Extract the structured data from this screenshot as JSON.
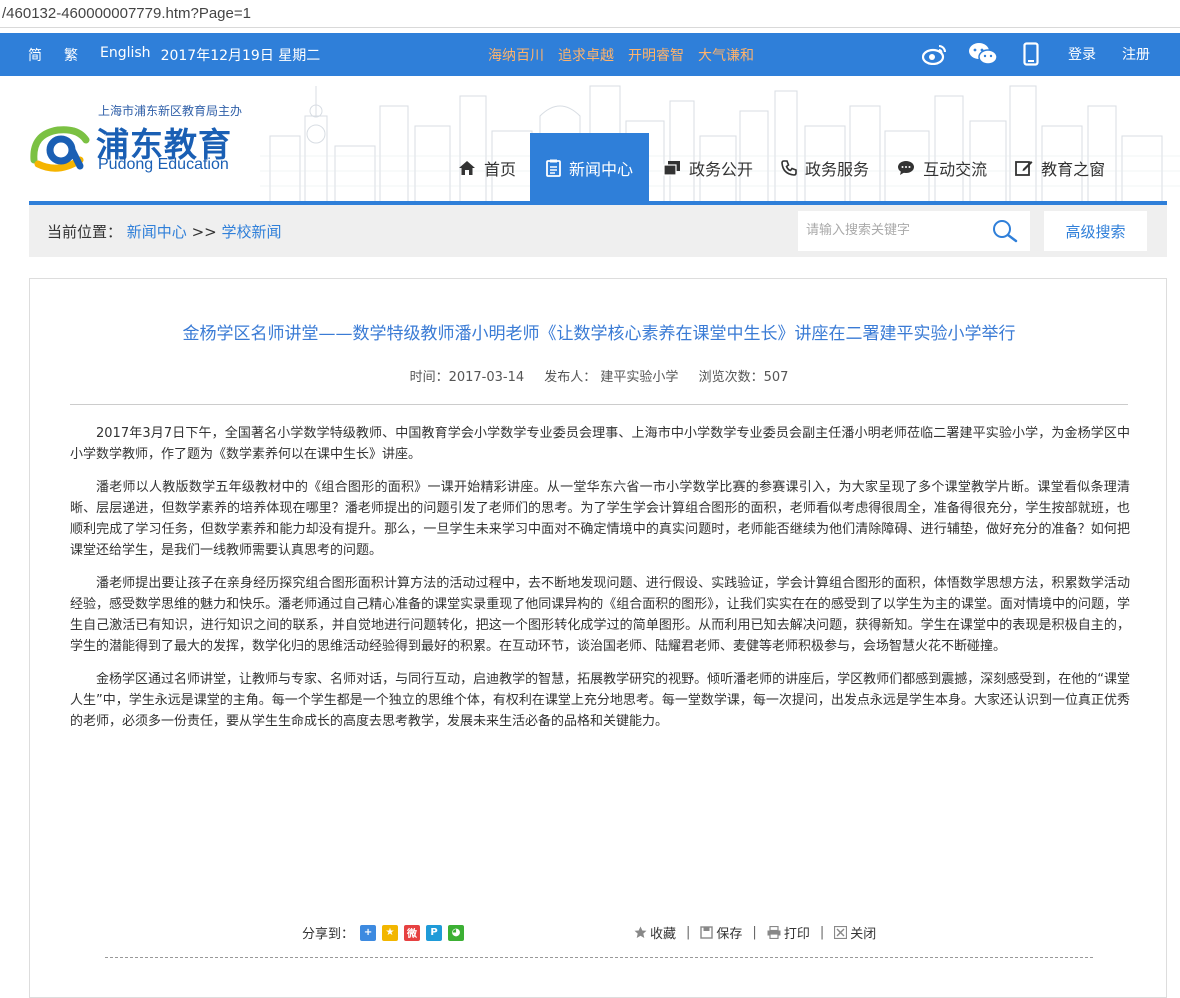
{
  "browser": {
    "url": "/460132-460000007779.htm?Page=1"
  },
  "topbar": {
    "lang_simplified": "简",
    "lang_traditional": "繁",
    "lang_english": "English",
    "date": "2017年12月19日 星期二",
    "slogans": [
      "海纳百川",
      "追求卓越",
      "开明睿智",
      "大气谦和"
    ],
    "login": "登录",
    "register": "注册",
    "icons": [
      "weibo-icon",
      "wechat-icon",
      "mobile-icon"
    ]
  },
  "logo": {
    "owner": "上海市浦东新区教育局主办",
    "name_cn": "浦东教育",
    "name_en": "Pudong Education"
  },
  "nav": {
    "items": [
      {
        "label": "首页",
        "icon": "home-icon"
      },
      {
        "label": "新闻中心",
        "icon": "document-icon",
        "active": true
      },
      {
        "label": "政务公开",
        "icon": "stack-icon"
      },
      {
        "label": "政务服务",
        "icon": "phone-icon"
      },
      {
        "label": "互动交流",
        "icon": "chat-icon"
      },
      {
        "label": "教育之窗",
        "icon": "edit-icon"
      }
    ]
  },
  "breadcrumb": {
    "prefix": "当前位置：",
    "level1": "新闻中心",
    "separator": ">>",
    "level2": "学校新闻"
  },
  "search": {
    "placeholder": "请输入搜索关键字",
    "advanced_label": "高级搜索"
  },
  "article": {
    "title": "金杨学区名师讲堂——数学特级教师潘小明老师《让数学核心素养在课堂中生长》讲座在二署建平实验小学举行",
    "time": "时间：2017-03-14",
    "publisher": "发布人： 建平实验小学",
    "views": "浏览次数：507",
    "paragraphs": [
      "2017年3月7日下午，全国著名小学数学特级教师、中国教育学会小学数学专业委员会理事、上海市中小学数学专业委员会副主任潘小明老师莅临二署建平实验小学，为金杨学区中小学数学教师，作了题为《数学素养何以在课中生长》讲座。",
      "潘老师以人教版数学五年级教材中的《组合图形的面积》一课开始精彩讲座。从一堂华东六省一市小学数学比赛的参赛课引入，为大家呈现了多个课堂教学片断。课堂看似条理清晰、层层递进，但数学素养的培养体现在哪里？潘老师提出的问题引发了老师们的思考。为了学生学会计算组合图形的面积，老师看似考虑得很周全，准备得很充分，学生按部就班，也顺利完成了学习任务，但数学素养和能力却没有提升。那么，一旦学生未来学习中面对不确定情境中的真实问题时，老师能否继续为他们清除障碍、进行辅垫，做好充分的准备？如何把课堂还给学生，是我们一线教师需要认真思考的问题。",
      "潘老师提出要让孩子在亲身经历探究组合图形面积计算方法的活动过程中，去不断地发现问题、进行假设、实践验证，学会计算组合图形的面积，体悟数学思想方法，积累数学活动经验，感受数学思维的魅力和快乐。潘老师通过自己精心准备的课堂实录重现了他同课异构的《组合面积的图形》，让我们实实在在的感受到了以学生为主的课堂。面对情境中的问题，学生自己激活已有知识，进行知识之间的联系，并自觉地进行问题转化，把这一个图形转化成学过的简单图形。从而利用已知去解决问题，获得新知。学生在课堂中的表现是积极自主的，学生的潜能得到了最大的发挥，数学化归的思维活动经验得到最好的积累。在互动环节，谈治国老师、陆耀君老师、麦健等老师积极参与，会场智慧火花不断碰撞。",
      "金杨学区通过名师讲堂，让教师与专家、名师对话，与同行互动，启迪教学的智慧，拓展教学研究的视野。倾听潘老师的讲座后，学区教师们都感到震撼，深刻感受到，在他的“课堂人生”中，学生永远是课堂的主角。每一个学生都是一个独立的思维个体，有权利在课堂上充分地思考。每一堂数学课，每一次提问，出发点永远是学生本身。大家还认识到一位真正优秀的老师，必须多一份责任，要从学生生命成长的高度去思考教学，发展未来生活必备的品格和关键能力。"
    ]
  },
  "share": {
    "label": "分享到：",
    "targets": [
      {
        "icon": "add-share-icon",
        "color": "#3d8ae0",
        "glyph": "+"
      },
      {
        "icon": "qzone-icon",
        "color": "#f2b600",
        "glyph": "★"
      },
      {
        "icon": "sina-weibo-icon",
        "color": "#e64141",
        "glyph": "微"
      },
      {
        "icon": "tencent-weibo-icon",
        "color": "#1f9bd8",
        "glyph": "P"
      },
      {
        "icon": "wechat-share-icon",
        "color": "#3cb034",
        "glyph": "◕"
      }
    ]
  },
  "tools": {
    "favorite": "收藏",
    "save": "保存",
    "print": "打印",
    "close": "关闭",
    "separator": "|"
  },
  "colors": {
    "primary": "#2f7fd9",
    "slogan": "#ffb36b",
    "title": "#3a7bd5"
  }
}
